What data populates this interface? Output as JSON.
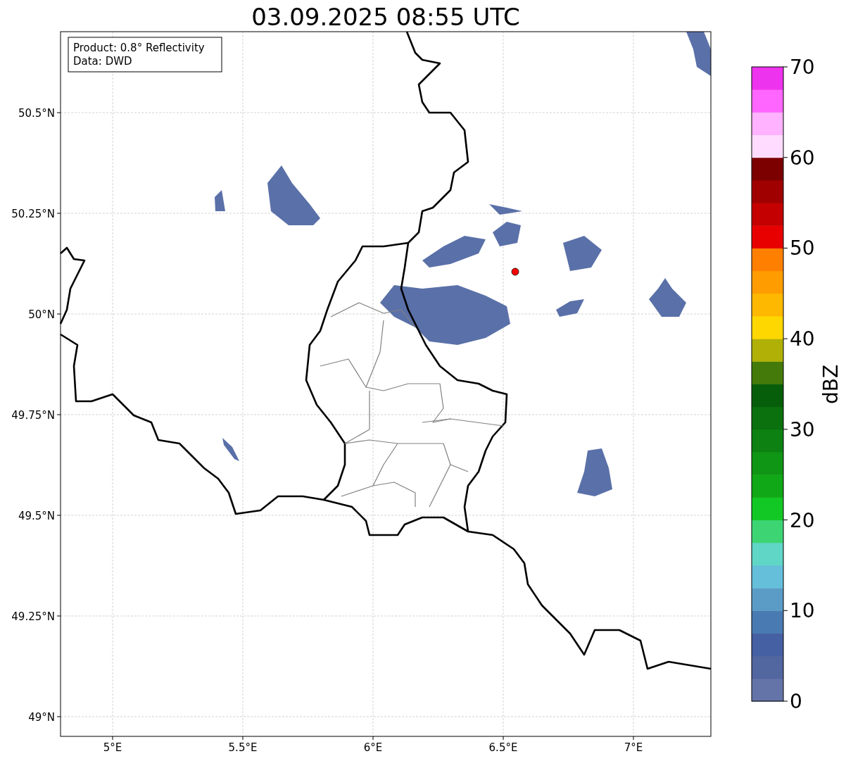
{
  "title": "03.09.2025 08:55 UTC",
  "info_box": {
    "lines": [
      "Product: 0.8° Reflectivity",
      "Data: DWD"
    ]
  },
  "map": {
    "xtick_labels": [
      "5°E",
      "5.5°E",
      "6°E",
      "6.5°E",
      "7°E"
    ],
    "ytick_labels": [
      "50.5°N",
      "50.25°N",
      "50°N",
      "49.75°N",
      "49.5°N",
      "49.25°N",
      "49°N"
    ]
  },
  "colorbar": {
    "label": "dBZ",
    "tick_labels": [
      "70",
      "60",
      "50",
      "40",
      "30",
      "20",
      "10",
      "0"
    ],
    "segments": [
      {
        "color": "#6574a8"
      },
      {
        "color": "#5266a0"
      },
      {
        "color": "#4560a3"
      },
      {
        "color": "#4a7ab2"
      },
      {
        "color": "#5a9cc6"
      },
      {
        "color": "#66bfda"
      },
      {
        "color": "#60d6c6"
      },
      {
        "color": "#3dd574"
      },
      {
        "color": "#12c824"
      },
      {
        "color": "#10a816"
      },
      {
        "color": "#0f9615"
      },
      {
        "color": "#0d8212"
      },
      {
        "color": "#0a710e"
      },
      {
        "color": "#065e0a"
      },
      {
        "color": "#437a0a"
      },
      {
        "color": "#b0b006"
      },
      {
        "color": "#ffd700"
      },
      {
        "color": "#ffb800"
      },
      {
        "color": "#ff9d00"
      },
      {
        "color": "#ff7f00"
      },
      {
        "color": "#e80000"
      },
      {
        "color": "#c40000"
      },
      {
        "color": "#a00000"
      },
      {
        "color": "#7c0000"
      },
      {
        "color": "#ffdcff"
      },
      {
        "color": "#ffb2ff"
      },
      {
        "color": "#ff66ff"
      },
      {
        "color": "#ee33ee"
      }
    ]
  }
}
